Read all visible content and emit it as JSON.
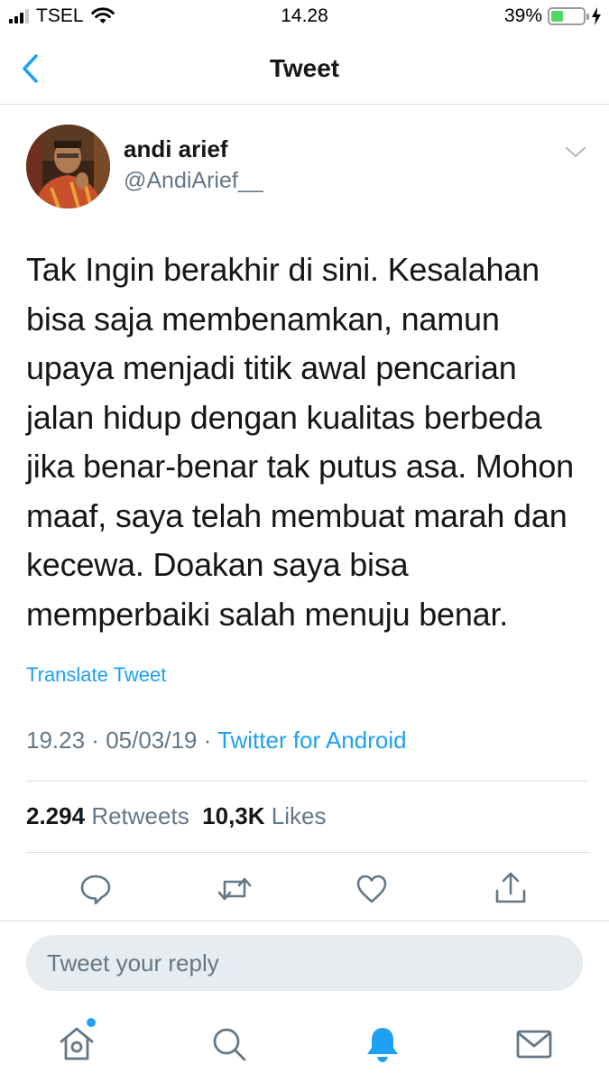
{
  "status_bar": {
    "carrier": "TSEL",
    "time": "14.28",
    "battery_percent": "39%",
    "battery_level": 0.39,
    "icons": [
      "signal-bars-icon",
      "wifi-icon",
      "battery-icon",
      "charging-bolt-icon"
    ]
  },
  "nav": {
    "title": "Tweet",
    "back_icon": "chevron-left-icon"
  },
  "tweet": {
    "author_name": "andi arief",
    "author_handle": "@AndiArief__",
    "lines": [
      "Tak Ingin berakhir di sini. Kesalahan",
      "bisa saja membenamkan, namun",
      "upaya menjadi titik awal  pencarian",
      "jalan hidup dengan kualitas berbeda",
      "jika benar-benar tak putus asa. Mohon",
      "maaf, saya telah membuat marah dan",
      "kecewa. Doakan saya bisa",
      "memperbaiki salah menuju benar."
    ],
    "translate_label": "Translate Tweet",
    "time": "19.23",
    "date": "05/03/19",
    "separator": " · ",
    "source": "Twitter for Android",
    "retweet_count": "2.294",
    "retweet_label": "Retweets",
    "like_count": "10,3K",
    "like_label": "Likes"
  },
  "actions": [
    "reply-icon",
    "retweet-icon",
    "like-icon",
    "share-icon"
  ],
  "reply": {
    "placeholder": "Tweet your reply"
  },
  "tab_bar": {
    "items": [
      "home-icon",
      "search-icon",
      "notifications-icon",
      "messages-icon"
    ],
    "active": "notifications-icon"
  },
  "colors": {
    "accent": "#1da1f2",
    "text": "#14171a",
    "muted": "#657786",
    "divider": "#d8dde1",
    "reply_bg": "#e6ecf0",
    "battery": "#4cd964"
  }
}
